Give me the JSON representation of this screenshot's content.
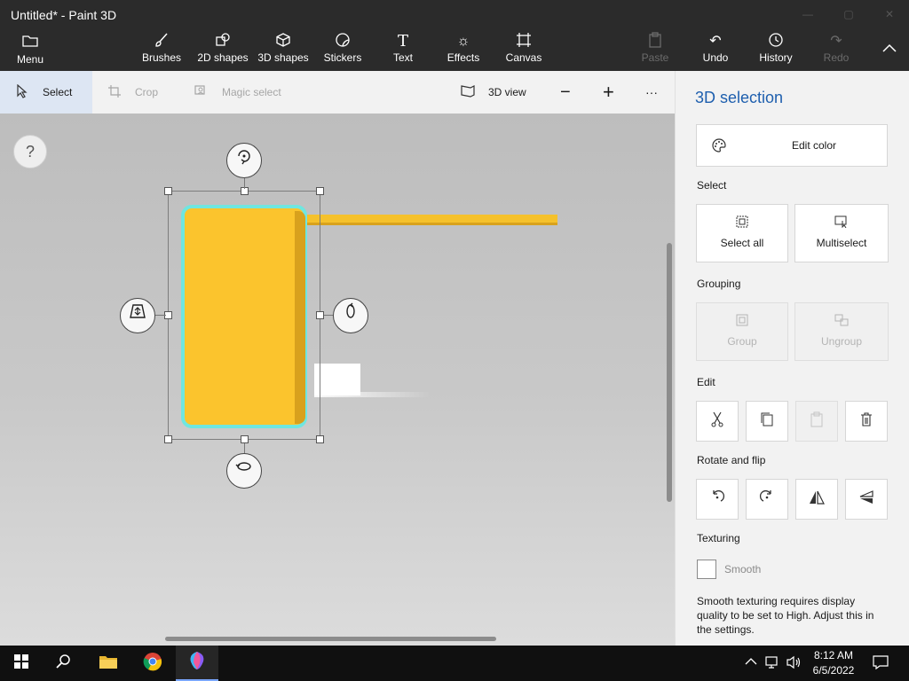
{
  "window": {
    "title": "Untitled* - Paint 3D"
  },
  "ribbon": {
    "menu": {
      "label": "Menu",
      "icon": "folder-icon"
    },
    "tools": [
      {
        "label": "Brushes",
        "icon": "brush-icon"
      },
      {
        "label": "2D shapes",
        "icon": "2d-shapes-icon"
      },
      {
        "label": "3D shapes",
        "icon": "cube-icon"
      },
      {
        "label": "Stickers",
        "icon": "sticker-icon"
      },
      {
        "label": "Text",
        "icon": "text-icon"
      },
      {
        "label": "Effects",
        "icon": "sun-icon"
      },
      {
        "label": "Canvas",
        "icon": "canvas-icon"
      }
    ],
    "actions": [
      {
        "label": "Paste",
        "icon": "paste-icon",
        "enabled": false
      },
      {
        "label": "Undo",
        "icon": "undo-icon",
        "enabled": true
      },
      {
        "label": "History",
        "icon": "history-icon",
        "enabled": true
      },
      {
        "label": "Redo",
        "icon": "redo-icon",
        "enabled": false
      }
    ]
  },
  "toolbar": {
    "select": "Select",
    "crop": "Crop",
    "magic_select": "Magic select",
    "view3d": "3D view",
    "zoom_out": "−",
    "zoom_in": "+",
    "more": "···"
  },
  "canvas": {
    "help": "?"
  },
  "panel": {
    "title": "3D selection",
    "edit_color": "Edit color",
    "select_heading": "Select",
    "select_all": "Select all",
    "multiselect": "Multiselect",
    "grouping_heading": "Grouping",
    "group": "Group",
    "ungroup": "Ungroup",
    "edit_heading": "Edit",
    "rotate_heading": "Rotate and flip",
    "texturing_heading": "Texturing",
    "smooth": "Smooth",
    "smooth_checked": false,
    "note": "Smooth texturing requires display quality to be set to High. Adjust this in the settings."
  },
  "taskbar": {
    "time": "8:12 AM",
    "date": "6/5/2022"
  },
  "colors": {
    "accent": "#1e5fae",
    "object_yellow": "#fbc42d",
    "selection_outline": "#6fe6e0"
  }
}
